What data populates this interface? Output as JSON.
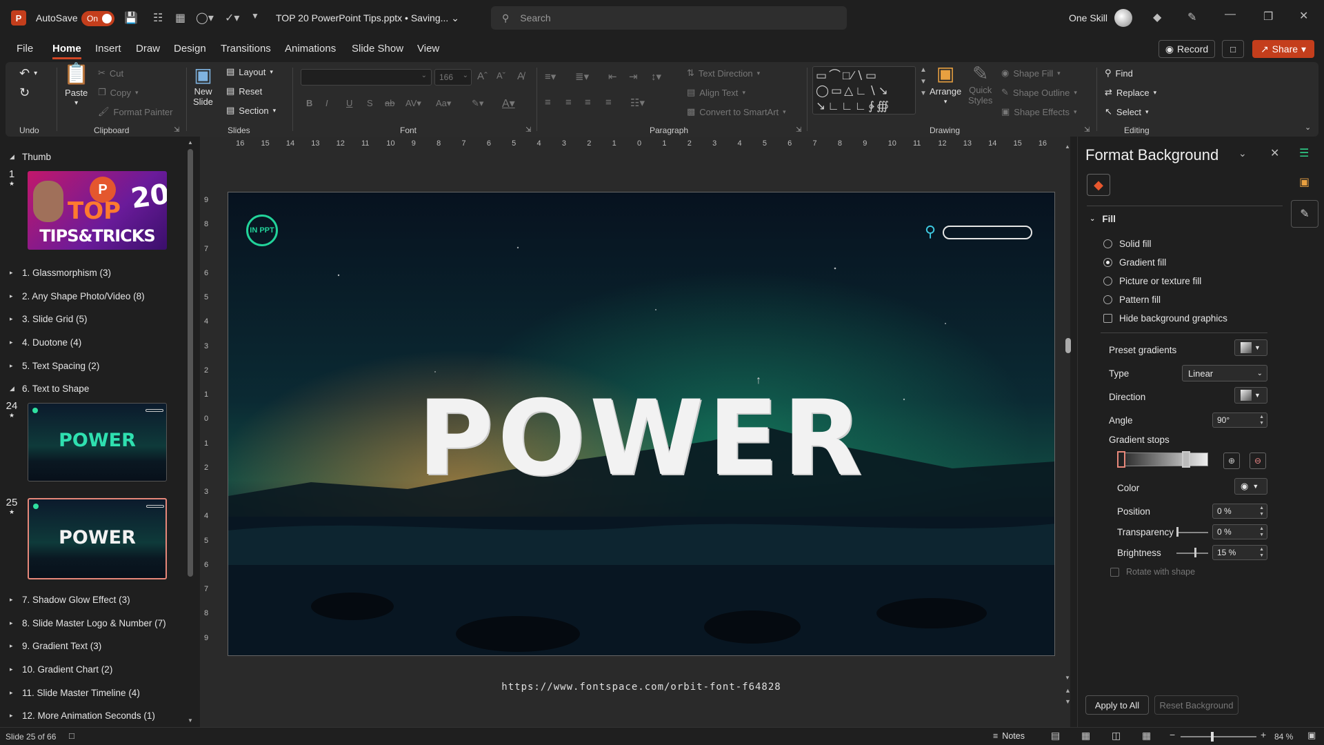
{
  "titlebar": {
    "app_logo": "P",
    "autosave_label": "AutoSave",
    "autosave_state": "On",
    "doc_title": "TOP 20 PowerPoint Tips.pptx • Saving...",
    "search_placeholder": "Search",
    "account_name": "One Skill"
  },
  "menu": {
    "tabs": [
      "File",
      "Home",
      "Insert",
      "Draw",
      "Design",
      "Transitions",
      "Animations",
      "Slide Show",
      "View"
    ],
    "record_label": "Record",
    "share_label": "Share"
  },
  "ribbon": {
    "undo": {
      "label": "Undo"
    },
    "clipboard": {
      "label": "Clipboard",
      "paste": "Paste",
      "cut": "Cut",
      "copy": "Copy",
      "format_painter": "Format Painter"
    },
    "slides": {
      "label": "Slides",
      "new_slide": "New",
      "new_slide2": "Slide",
      "layout": "Layout",
      "reset": "Reset",
      "section": "Section"
    },
    "font": {
      "label": "Font",
      "font_size": "166"
    },
    "paragraph": {
      "label": "Paragraph",
      "text_direction": "Text Direction",
      "align_text": "Align Text",
      "convert_smartart": "Convert to SmartArt"
    },
    "drawing": {
      "label": "Drawing",
      "arrange": "Arrange",
      "quick_styles": "Quick",
      "quick_styles2": "Styles",
      "shape_fill": "Shape Fill",
      "shape_outline": "Shape Outline",
      "shape_effects": "Shape Effects"
    },
    "editing": {
      "label": "Editing",
      "find": "Find",
      "replace": "Replace",
      "select": "Select"
    }
  },
  "left_panel": {
    "root_section": "Thumb",
    "sections_top": [
      "1. Glassmorphism (3)",
      "2. Any Shape Photo/Video (8)",
      "3. Slide Grid (5)",
      "4. Duotone (4)",
      "5. Text Spacing (2)",
      "6. Text to Shape"
    ],
    "sections_bottom": [
      "7. Shadow Glow Effect (3)",
      "8. Slide Master Logo & Number (7)",
      "9. Gradient Text (3)",
      "10. Gradient Chart (2)",
      "11. Slide Master Timeline (4)",
      "12. More Animation Seconds (1)"
    ],
    "slides": [
      {
        "num": "1",
        "caption_top": "TOP",
        "caption_num": "20",
        "caption_bottom": "TIPS&TRICKS"
      },
      {
        "num": "24",
        "caption": "POWER"
      },
      {
        "num": "25",
        "caption": "POWER"
      }
    ]
  },
  "ruler": {
    "h_ticks": [
      "16",
      "15",
      "14",
      "13",
      "12",
      "11",
      "10",
      "9",
      "8",
      "7",
      "6",
      "5",
      "4",
      "3",
      "2",
      "1",
      "0",
      "1",
      "2",
      "3",
      "4",
      "5",
      "6",
      "7",
      "8",
      "9",
      "10",
      "11",
      "12",
      "13",
      "14",
      "15",
      "16"
    ],
    "v_ticks": [
      "9",
      "8",
      "7",
      "6",
      "5",
      "4",
      "3",
      "2",
      "1",
      "0",
      "1",
      "2",
      "3",
      "4",
      "5",
      "6",
      "7",
      "8",
      "9"
    ]
  },
  "slide": {
    "logo_text": "IN PPT",
    "headline": "POWER",
    "url": "https://www.fontspace.com/orbit-font-f64828"
  },
  "format_pane": {
    "title": "Format Background",
    "fill_section": "Fill",
    "options": [
      "Solid fill",
      "Gradient fill",
      "Picture or texture fill",
      "Pattern fill"
    ],
    "hide_bg": "Hide background graphics",
    "preset_gradients": "Preset gradients",
    "type_label": "Type",
    "type_value": "Linear",
    "direction_label": "Direction",
    "angle_label": "Angle",
    "angle_value": "90°",
    "gradient_stops": "Gradient stops",
    "color_label": "Color",
    "position_label": "Position",
    "position_value": "0 %",
    "transparency_label": "Transparency",
    "transparency_value": "0 %",
    "brightness_label": "Brightness",
    "brightness_value": "15 %",
    "rotate_label": "Rotate with shape",
    "apply_all": "Apply to All",
    "reset_bg": "Reset Background"
  },
  "status": {
    "slide_info": "Slide 25 of 66",
    "notes": "Notes",
    "zoom": "84 %"
  },
  "colors": {
    "accent": "#c43e1c",
    "selected_thumb": "#e8887a"
  }
}
